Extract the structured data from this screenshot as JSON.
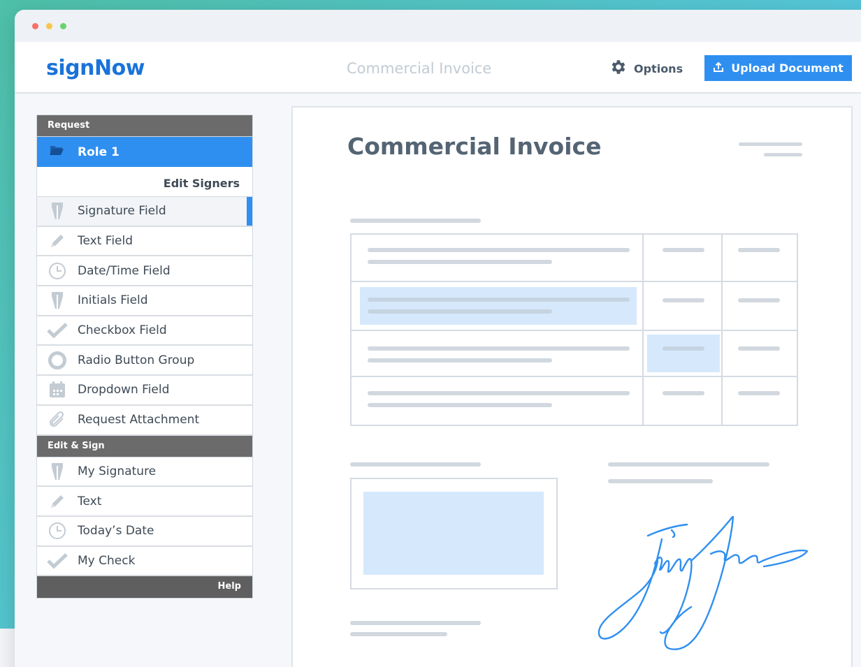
{
  "app": {
    "logo": "signNow",
    "document_title": "Commercial Invoice",
    "options_label": "Options",
    "upload_label": "Upload Document"
  },
  "sidebar": {
    "request_header": "Request",
    "role_label": "Role 1",
    "edit_signers_label": "Edit Signers",
    "request_items": [
      {
        "label": "Signature Field",
        "icon": "pen-nib-icon"
      },
      {
        "label": "Text Field",
        "icon": "pencil-icon"
      },
      {
        "label": "Date/Time Field",
        "icon": "clock-icon"
      },
      {
        "label": "Initials Field",
        "icon": "pen-nib-icon"
      },
      {
        "label": "Checkbox Field",
        "icon": "checkmark-icon"
      },
      {
        "label": "Radio Button Group",
        "icon": "radio-circle-icon"
      },
      {
        "label": "Dropdown Field",
        "icon": "calendar-icon"
      },
      {
        "label": "Request Attachment",
        "icon": "paperclip-icon"
      }
    ],
    "edit_sign_header": "Edit & Sign",
    "edit_sign_items": [
      {
        "label": "My Signature",
        "icon": "pen-nib-icon"
      },
      {
        "label": "Text",
        "icon": "pencil-icon"
      },
      {
        "label": "Today’s Date",
        "icon": "clock-icon"
      },
      {
        "label": "My Check",
        "icon": "checkmark-icon"
      }
    ],
    "help_label": "Help",
    "selected_item": "Signature Field"
  },
  "document": {
    "heading": "Commercial Invoice"
  },
  "colors": {
    "brand_blue": "#1a73d9",
    "accent_blue": "#2f8ff0",
    "section_header_gray": "#6b6b6b",
    "highlight_fill": "#d6e9fc",
    "signature_ink": "#2f8ff0"
  }
}
